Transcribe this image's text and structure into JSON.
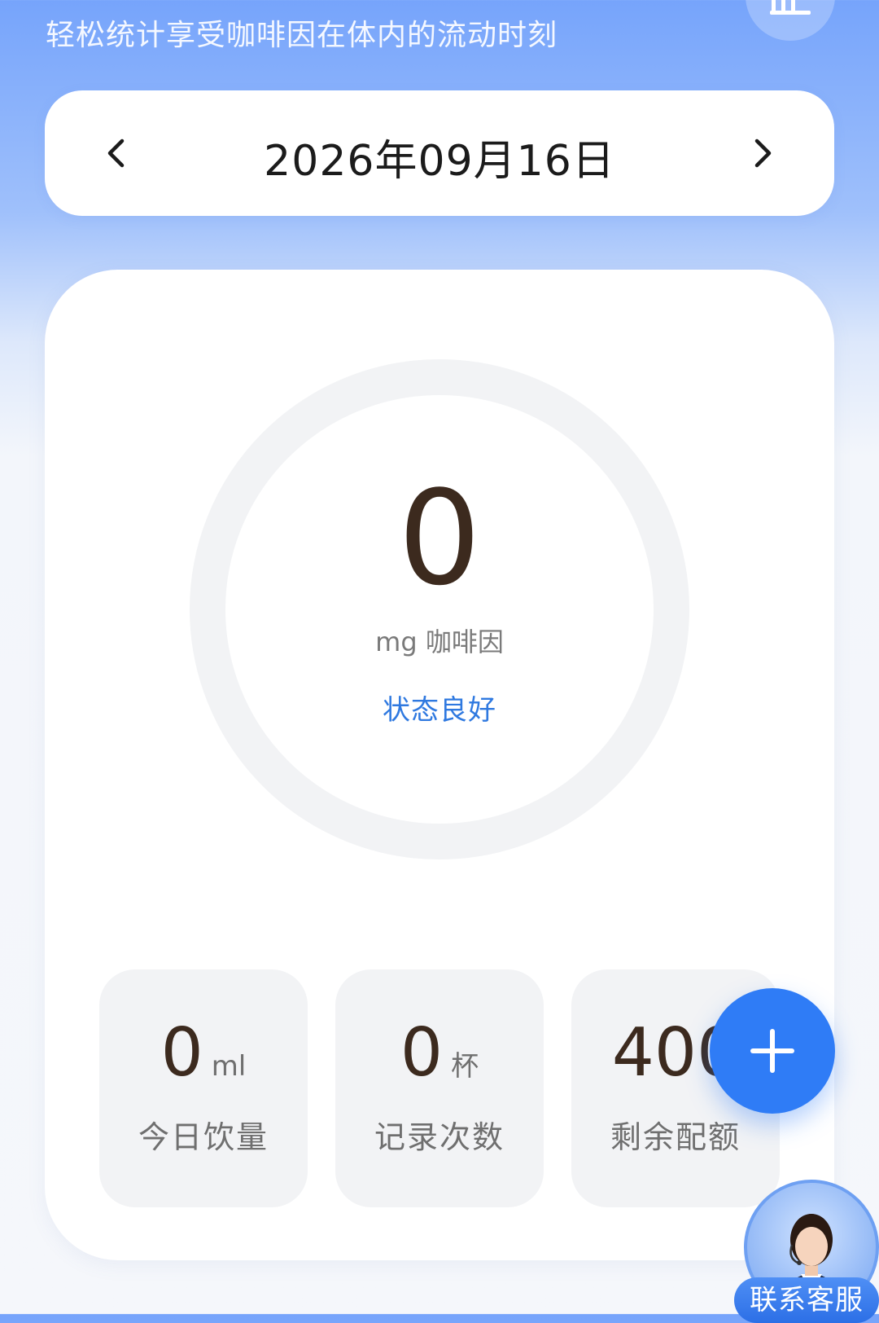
{
  "header": {
    "subtitle": "轻松统计享受咖啡因在体内的流动时刻",
    "stats_icon": "bar-chart-icon"
  },
  "date_nav": {
    "date": "2026年09月16日",
    "prev_icon": "chevron-left-icon",
    "next_icon": "chevron-right-icon"
  },
  "summary": {
    "caffeine_value": "0",
    "caffeine_unit": "mg 咖啡因",
    "status": "状态良好",
    "progress_fraction": 0
  },
  "stats": [
    {
      "value": "0",
      "unit": "ml",
      "label": "今日饮量"
    },
    {
      "value": "0",
      "unit": "杯",
      "label": "记录次数"
    },
    {
      "value": "400",
      "unit": "",
      "label": "剩余配额"
    }
  ],
  "fab": {
    "icon": "plus-icon"
  },
  "customer_service": {
    "label": "联系客服",
    "icon": "agent-avatar-icon"
  },
  "colors": {
    "accent": "#2f7cf6",
    "status": "#2f79e0",
    "value_text": "#3c2a1e",
    "ring_track": "#f2f3f5"
  }
}
